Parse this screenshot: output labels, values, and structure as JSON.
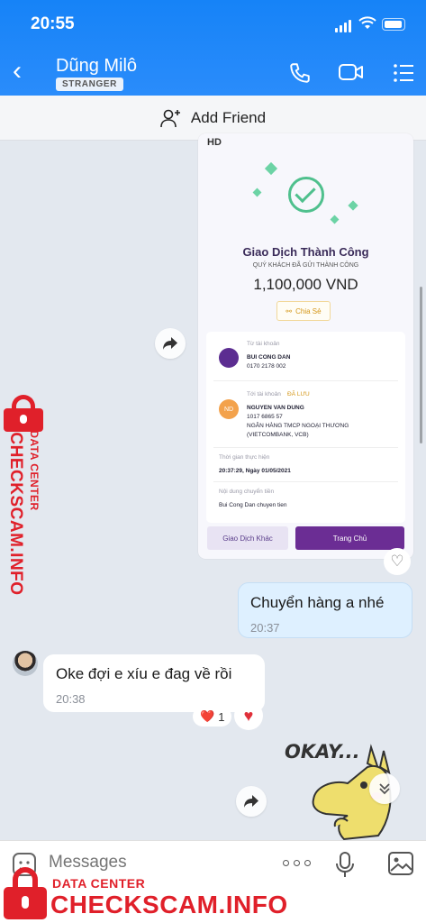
{
  "status_bar": {
    "time": "20:55"
  },
  "header": {
    "contact_name": "Dũng Milô",
    "badge": "STRANGER"
  },
  "add_friend": {
    "label": "Add Friend"
  },
  "receipt": {
    "hd": "HD",
    "title": "Giao Dịch Thành Công",
    "subtitle": "QUÝ KHÁCH ĐÃ GỬI THÀNH CÔNG",
    "amount": "1,100,000 VND",
    "share_label": "Chia Sẻ",
    "from_label": "Từ tài khoản",
    "from_name": "BUI CONG DAN",
    "from_account": "0170 2178 002",
    "to_label": "Tới tài khoản",
    "saved_tag": "ĐÃ LƯU",
    "to_initials": "ND",
    "to_name": "NGUYEN VAN DUNG",
    "to_account": "1017 6865 57",
    "to_bank": "NGÂN HÀNG TMCP NGOẠI THƯƠNG",
    "to_bank_short": "(VIETCOMBANK, VCB)",
    "time_label": "Thời gian thực hiện",
    "time_value": "20:37:29, Ngày 01/05/2021",
    "content_label": "Nội dung chuyển tiền",
    "content_value": "Bui Cong Dan chuyen tien",
    "btn_other": "Giao Dịch Khác",
    "btn_home": "Trang Chủ"
  },
  "messages": [
    {
      "text": "Chuyển hàng a nhé",
      "time": "20:37"
    },
    {
      "text": "Oke đợi e xíu e đag về rồi",
      "time": "20:38"
    }
  ],
  "reaction": {
    "emoji": "❤️",
    "count": "1"
  },
  "sticker": {
    "text": "OKAY..."
  },
  "composer": {
    "placeholder": "Messages"
  },
  "watermark": {
    "data_center": "DATA CENTER",
    "brand": "CHECKSCAM.INFO"
  },
  "colors": {
    "header": "#1683f7",
    "receipt_accent": "#6b2d94",
    "watermark": "#e0202a"
  }
}
